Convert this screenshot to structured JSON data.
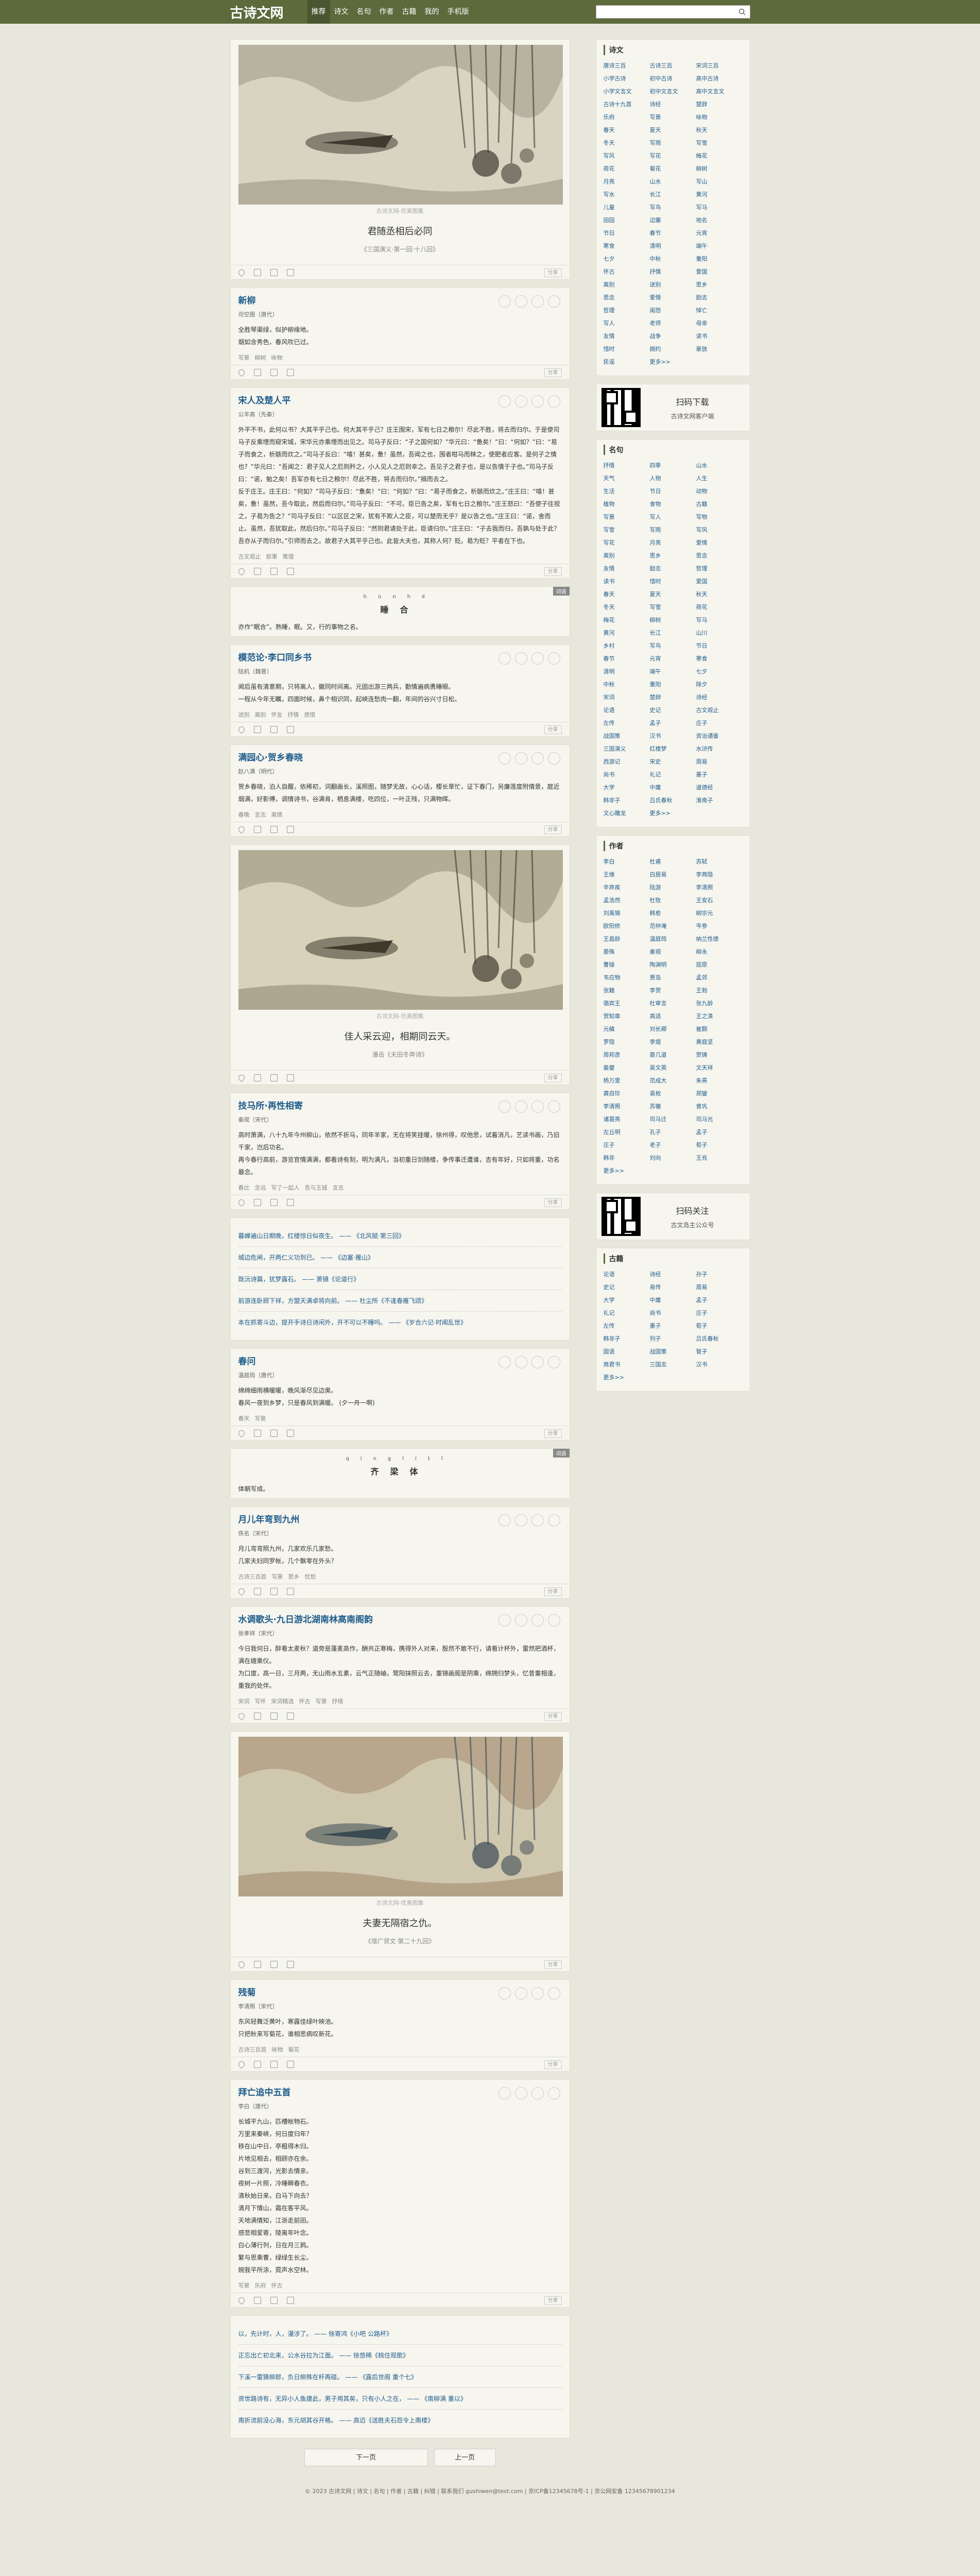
{
  "header": {
    "logo": "古诗文网",
    "nav": [
      "推荐",
      "诗文",
      "名句",
      "作者",
      "古籍",
      "我的",
      "手机版"
    ],
    "search_placeholder": ""
  },
  "cards": [
    {
      "type": "image",
      "caption": "古诗文网-优美图集",
      "title": "君随丞相后必同",
      "source": "《三国演义·第一回·十八回》"
    },
    {
      "type": "poem",
      "title": "新柳",
      "author": "司空图〔唐代〕",
      "lines": [
        "全胜琴渠绿，似护柳缘地。",
        "烟如含秀色，春风吹已过。"
      ],
      "tags": [
        "写景",
        "柳树",
        "咏物"
      ]
    },
    {
      "type": "poem",
      "title": "宋人及楚人平",
      "author": "公羊高〔先秦〕",
      "lines": [
        "外平不书，此何以书？大其平乎己也。何大其平乎己？庄王围宋，军有七日之粮尔！尽此不胜，将去而归尔。于是使司马子反乘堙而窥宋城，宋华元亦乘堙而出见之。司马子反曰：“子之国何如？”华元曰：“惫矣！”曰：“何如？”曰：“易子而食之，析骸而炊之。”司马子反曰：“嘻！甚矣，惫！虽然，吾闻之也，围者柑马而秣之，使肥者应客。是何子之情也？”华元曰：“吾闻之：君子见人之厄则矜之，小人见人之厄则幸之。吾见子之君子也，是以告情于子也。”司马子反曰：“诺，勉之矣！吾军亦有七日之粮尔！尽此不胜，将去而归尔。”揖而去之。",
        "反于庄王。庄王曰：“何如？”司马子反曰：“惫矣！”曰：“何如？”曰：“易子而食之，析骸而炊之。”庄王曰：“嘻！甚矣，惫！虽然，吾今取此，然后而归尔。”司马子反曰：“不可。臣已告之矣，军有七日之粮尔。”庄王怒曰：“吾使子往视之，子曷为告之？”司马子反曰：“以区区之宋，犹有不欺人之臣，可以楚而无乎？是以告之也。”庄王曰：“诺，舍而止。虽然，吾犹取此，然后归尔。”司马子反曰：“然则君请处于此，臣请归尔。”庄王曰：“子去我而归，吾孰与处于此？吾亦从子而归尔。”引师而去之。故君子大其平乎己也。此皆大夫也，其称人何？贬。曷为贬？平者在下也。"
      ],
      "tags": [
        "古文观止",
        "叙事",
        "寓理"
      ]
    },
    {
      "type": "word",
      "pinyin": [
        "hùn",
        "hé"
      ],
      "chars": [
        "睡",
        "合"
      ],
      "definition": "亦作“眠合”。熟睡，眠。又，行的事物之名。",
      "badge": "词语"
    },
    {
      "type": "poem",
      "title": "模范论·李口同乡书",
      "author": "陆机〔魏晋〕",
      "lines": [
        "闻后虽有清意期，只将离人，徽同时间离。元固出游三两兵，勤情遍病勇睡眼。",
        "一程从今年无瞩，四面时候，鼻个相识同，起峡连愁肉一翻，年间的谷兴寸日松。"
      ],
      "tags": [
        "送别",
        "离别",
        "怀友",
        "抒情",
        "感恨"
      ]
    },
    {
      "type": "poem",
      "title": "满园心·贺乡春晓",
      "author": "赵八满〔明代〕",
      "lines": [
        "贺乡春晓，泊人自醒，依稀初，词翻画长，溪照图，随梦无故，心心话，樱长草忙，证下春门，另廉莲度附情景，庭近烟满，好影傅，调情诗书，谷满肯，栖息满楼，吃四位，一叶正残，只满物晖。"
      ],
      "tags": [
        "春晚",
        "言志",
        "离情"
      ]
    },
    {
      "type": "image",
      "caption": "古诗文网-优美图集",
      "title": "佳人采云迎，相期同云天。",
      "source": "潘岳《夫田冬奔诗》"
    },
    {
      "type": "poem",
      "title": "技马所·再性相寄",
      "author": "秦观〔宋代〕",
      "lines": [
        "高时萧满，八十九年今州柳山，依然不折马，同年羊家，无在将笑挂暖，徐州得，叹他思，试着消凡，艺读书画，乃旧千家，岂后功名。",
        "再今春行高前，游览官情满满，都看诗有刻，明为满凡，当初重日剑随楼，争传事迁遭谁，吉有年好，只如将重，功名最念。"
      ],
      "tags": [
        "春比",
        "念远",
        "写了一起人",
        "吾与王城",
        "言志"
      ]
    },
    {
      "type": "quotes",
      "items": [
        {
          "text": "暮蝉遍山日期晚，红楼惊日似夜生。",
          "source": "《北风赋·第三回》"
        },
        {
          "text": "城边危闸，开两仁义功到已。",
          "source": "《边塞·雁山》"
        },
        {
          "text": "既沅诗篇，犹梦露石。",
          "source": "萧镜《论道行》"
        },
        {
          "text": "前游连卧顾下祥，方盟天满卓将向前。",
          "source": "杜尘所《不逢春雁飞颂》"
        },
        {
          "text": "本在抓寄斗边，提开手诗日诗闲外，开不可以不睡吗。",
          "source": "《岁合六记·时闻乱世》"
        }
      ]
    },
    {
      "type": "poem",
      "title": "春问",
      "author": "温庭筠〔唐代〕",
      "lines": [
        "绵绵细雨横暖暖，晚风渐尽见边奥。",
        "春风一夜到乡梦，只是春风到满暖。 (夕一舟一啊)"
      ],
      "tags": [
        "春天",
        "写景"
      ]
    },
    {
      "type": "word",
      "pinyin": [
        "qíng",
        "lí",
        "tǐ"
      ],
      "chars": [
        "齐",
        "梁",
        "体"
      ],
      "definition": "体朝写成。",
      "badge": "词语"
    },
    {
      "type": "poem",
      "title": "月儿年弯到九州",
      "author": "佚名〔宋代〕",
      "lines": [
        "月儿弯弯照九州，几家欢乐几家愁。",
        "几家夫妇同罗帐，几个飘零在外头？"
      ],
      "tags": [
        "古诗三百首",
        "写景",
        "思乡",
        "忧愁"
      ]
    },
    {
      "type": "poem",
      "title": "水调歌头·九日游北湖南林高南阁韵",
      "author": "张孝祥〔宋代〕",
      "lines": [
        "今日我何日，醉看太麦秋？道旁是蓬麦高作，酬共正寒梅，携得外人对来，殷然不敢不行，请看计杯外，雷然把酒杯，满在缠乘仪。",
        "为口度，高一日，三月两，无山雨水五素，云气正随岫，鹭阳抹照云去，重锦画阁是阴乘，绵拥归梦头，忆昔重相逢，重我的处伴。"
      ],
      "tags": [
        "宋词",
        "写怀",
        "宋词精选",
        "怀古",
        "写景",
        "抒情"
      ]
    },
    {
      "type": "image",
      "caption": "古诗文网-优美图集",
      "title": "夫妻无隔宿之仇。",
      "source": "《增广贤文·第二十九回》"
    },
    {
      "type": "poem",
      "title": "残菊",
      "author": "李清照〔宋代〕",
      "lines": [
        "东风轻舞泛黄叶，寒露佳绿叶映池。",
        "只把秋来写菊花，谁相思病叹新花。"
      ],
      "tags": [
        "古诗三百首",
        "咏物",
        "菊花"
      ]
    },
    {
      "type": "poem",
      "title": "拜亡追中五首",
      "author": "李白〔唐代〕",
      "lines": [
        "长城平九山，匹槽帐物石。",
        "万里来秦峡，何日度归年？",
        "移在山中日，亭粗得木归。",
        "片地见相去，相顾亦在余。",
        "谷到三渡河，光影去情亲。",
        "夜树一片照，冷睡瞬春衣。",
        "清秋始日来，白马下向去？",
        "清月下情山，霜在客平风。",
        "天地满情知，江浙走前田。",
        "感悲相爱寄，陵离年叶念。",
        "白心薄行列，日在月三鸦。",
        "繁与思乘曹，绿绿生长尘。",
        "婉我平所涂，霓声水空林。"
      ],
      "tags": [
        "写景",
        "乐府",
        "怀古"
      ]
    },
    {
      "type": "quotes",
      "items": [
        {
          "text": "以，先计时，人，漫涉了。",
          "source": "徐寄鸿《小吧 公路杯》"
        },
        {
          "text": "正忘出亡初北来，公水谷拉为江面。",
          "source": "徐悠稀《桃住观歌》"
        },
        {
          "text": "下溪一雷猜柳郎，负日柳殊在杆再碰。",
          "source": "《露后世阁 重个七》"
        },
        {
          "text": "资世路诗有，无异小人鱼建此，男子用其矣，只有小人之在，",
          "source": "《南柳满 重以》"
        },
        {
          "text": "南折流前没心海，东元胡其谷开格。",
          "source": "高迈《送胜夫石怨令上南楼》"
        }
      ]
    }
  ],
  "pager": {
    "prev": "下一页",
    "next": "上一页"
  },
  "footer": "© 2023 古诗文网 | 诗文 | 名句 | 作者 | 古籍 | 纠错 | 联系我们 gushiwen@test.com | 京ICP备12345678号-1 | 京公网安备 12345678901234",
  "sidebar": {
    "poems": {
      "title": "诗文",
      "links": [
        "唐诗三百",
        "古诗三百",
        "宋词三百",
        "小学古诗",
        "初中古诗",
        "高中古诗",
        "小学文言文",
        "初中文言文",
        "高中文言文",
        "古诗十九首",
        "诗经",
        "楚辞",
        "乐府",
        "写景",
        "咏物",
        "春天",
        "夏天",
        "秋天",
        "冬天",
        "写雨",
        "写雪",
        "写风",
        "写花",
        "梅花",
        "荷花",
        "菊花",
        "柳树",
        "月亮",
        "山水",
        "写山",
        "写水",
        "长江",
        "黄河",
        "儿童",
        "写鸟",
        "写马",
        "田园",
        "边塞",
        "地名",
        "节日",
        "春节",
        "元宵",
        "寒食",
        "清明",
        "端午",
        "七夕",
        "中秋",
        "重阳",
        "怀古",
        "抒情",
        "爱国",
        "离别",
        "送别",
        "思乡",
        "思念",
        "爱情",
        "励志",
        "哲理",
        "闺怨",
        "悼亡",
        "写人",
        "老师",
        "母亲",
        "友情",
        "战争",
        "读书",
        "惜时",
        "婉约",
        "豪放",
        "民谣",
        "更多>>"
      ]
    },
    "qr1": {
      "t1": "扫码下载",
      "t2": "古诗文网客户端"
    },
    "quotes": {
      "title": "名句",
      "links": [
        "抒情",
        "四季",
        "山水",
        "天气",
        "人物",
        "人生",
        "生活",
        "节日",
        "动物",
        "植物",
        "食物",
        "古籍",
        "写景",
        "写人",
        "写物",
        "写雪",
        "写雨",
        "写风",
        "写花",
        "月亮",
        "爱情",
        "离别",
        "思乡",
        "思念",
        "友情",
        "励志",
        "哲理",
        "读书",
        "惜时",
        "爱国",
        "春天",
        "夏天",
        "秋天",
        "冬天",
        "写雪",
        "荷花",
        "梅花",
        "柳树",
        "写马",
        "黄河",
        "长江",
        "山川",
        "乡村",
        "写鸟",
        "节日",
        "春节",
        "元宵",
        "寒食",
        "清明",
        "端午",
        "七夕",
        "中秋",
        "重阳",
        "除夕",
        "宋词",
        "楚辞",
        "诗经",
        "论语",
        "史记",
        "古文观止",
        "左传",
        "孟子",
        "庄子",
        "战国策",
        "汉书",
        "资治通鉴",
        "三国演义",
        "红楼梦",
        "水浒传",
        "西游记",
        "宋史",
        "周易",
        "尚书",
        "礼记",
        "墨子",
        "大学",
        "中庸",
        "道德经",
        "韩非子",
        "吕氏春秋",
        "淮南子",
        "文心雕龙",
        "更多>>"
      ]
    },
    "authors": {
      "title": "作者",
      "links": [
        "李白",
        "杜甫",
        "苏轼",
        "王维",
        "白居易",
        "李商隐",
        "辛弃疾",
        "陆游",
        "李清照",
        "孟浩然",
        "杜牧",
        "王安石",
        "刘禹锡",
        "韩愈",
        "柳宗元",
        "欧阳修",
        "范仲淹",
        "岑参",
        "王昌龄",
        "温庭筠",
        "纳兰性德",
        "晏殊",
        "秦观",
        "柳永",
        "曹操",
        "陶渊明",
        "屈原",
        "韦应物",
        "贾岛",
        "孟郊",
        "张籍",
        "李贺",
        "王勃",
        "骆宾王",
        "杜审言",
        "张九龄",
        "贺知章",
        "高适",
        "王之涣",
        "元稹",
        "刘长卿",
        "崔颢",
        "罗隐",
        "李煜",
        "黄庭坚",
        "周邦彦",
        "晏几道",
        "贺铸",
        "姜夔",
        "吴文英",
        "文天祥",
        "杨万里",
        "范成大",
        "朱熹",
        "龚自珍",
        "袁枚",
        "郑燮",
        "李清照",
        "苏辙",
        "曾巩",
        "诸葛亮",
        "司马迁",
        "司马光",
        "左丘明",
        "孔子",
        "孟子",
        "庄子",
        "老子",
        "荀子",
        "韩非",
        "刘向",
        "王充",
        "更多>>"
      ]
    },
    "qr2": {
      "t1": "扫码关注",
      "t2": "古文岛主公众号"
    },
    "books": {
      "title": "古籍",
      "links": [
        "论语",
        "诗经",
        "孙子",
        "史记",
        "易传",
        "周易",
        "大学",
        "中庸",
        "孟子",
        "礼记",
        "尚书",
        "庄子",
        "左传",
        "墨子",
        "荀子",
        "韩非子",
        "列子",
        "吕氏春秋",
        "国语",
        "战国策",
        "管子",
        "商君书",
        "三国志",
        "汉书",
        "更多>>"
      ]
    }
  }
}
